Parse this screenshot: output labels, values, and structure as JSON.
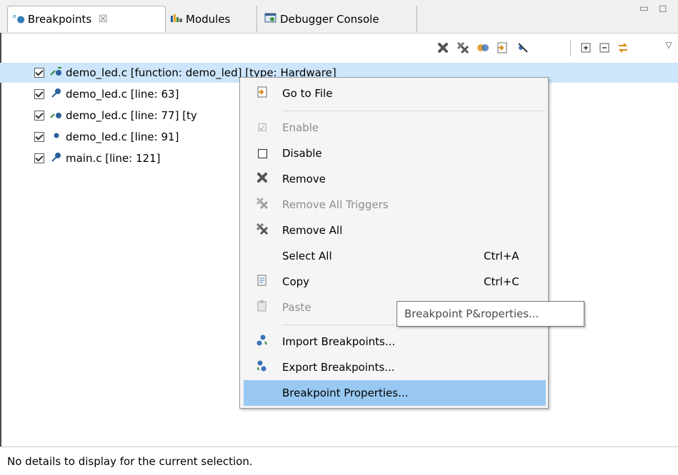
{
  "tabs": [
    {
      "label": "Breakpoints",
      "icon": "breakpoints-icon",
      "close": "☒"
    },
    {
      "label": "Modules",
      "icon": "modules-icon"
    },
    {
      "label": "Debugger Console",
      "icon": "console-icon"
    }
  ],
  "window_controls": {
    "minimize": "▭",
    "maximize": "◻"
  },
  "toolbar": {
    "icons": [
      "remove-icon",
      "remove-all-icon",
      "link-icon",
      "go-to-file-icon",
      "skip-all-icon",
      "expand-all-icon",
      "collapse-all-icon",
      "link-with-debug-view-icon",
      "view-menu-icon"
    ]
  },
  "breakpoints": [
    {
      "label": "demo_led.c [function: demo_led] [type: Hardware]",
      "checked": true,
      "icon": "function-breakpoint-icon",
      "selected": true
    },
    {
      "label": "demo_led.c [line: 63]",
      "checked": true,
      "icon": "line-breakpoint-icon"
    },
    {
      "label": "demo_led.c [line: 77] [ty",
      "checked": true,
      "icon": "hardware-breakpoint-icon"
    },
    {
      "label": "demo_led.c [line: 91]",
      "checked": true,
      "icon": "breakpoint-dot-icon"
    },
    {
      "label": "main.c [line: 121]",
      "checked": true,
      "icon": "line-breakpoint-icon"
    }
  ],
  "context_menu": {
    "items": [
      {
        "label": "Go to File",
        "shortcut": "",
        "enabled": true,
        "icon": "go-to-file-icon"
      },
      {
        "label": "Enable",
        "shortcut": "",
        "enabled": false,
        "icon": "checkbox-checked-icon"
      },
      {
        "label": "Disable",
        "shortcut": "",
        "enabled": true,
        "icon": "checkbox-empty-icon"
      },
      {
        "label": "Remove",
        "shortcut": "",
        "enabled": true,
        "icon": "remove-icon"
      },
      {
        "label": "Remove All Triggers",
        "shortcut": "",
        "enabled": false,
        "icon": "remove-all-triggers-icon"
      },
      {
        "label": "Remove All",
        "shortcut": "",
        "enabled": true,
        "icon": "remove-all-icon"
      },
      {
        "label": "Select All",
        "shortcut": "Ctrl+A",
        "enabled": true,
        "icon": ""
      },
      {
        "label": "Copy",
        "shortcut": "Ctrl+C",
        "enabled": true,
        "icon": "copy-icon"
      },
      {
        "label": "Paste",
        "shortcut": "",
        "enabled": false,
        "icon": "paste-icon"
      },
      {
        "label": "Import Breakpoints...",
        "shortcut": "",
        "enabled": true,
        "icon": "import-breakpoints-icon"
      },
      {
        "label": "Export Breakpoints...",
        "shortcut": "",
        "enabled": true,
        "icon": "export-breakpoints-icon"
      },
      {
        "label": "Breakpoint Properties...",
        "shortcut": "",
        "enabled": true,
        "icon": "",
        "highlighted": true
      }
    ]
  },
  "tooltip": {
    "text": "Breakpoint P&roperties..."
  },
  "details": {
    "text": "No details to display for the current selection."
  },
  "colors": {
    "selection": "#cde6fb",
    "menu_highlight": "#99c9f2",
    "disabled_text": "#8d8d8d"
  }
}
